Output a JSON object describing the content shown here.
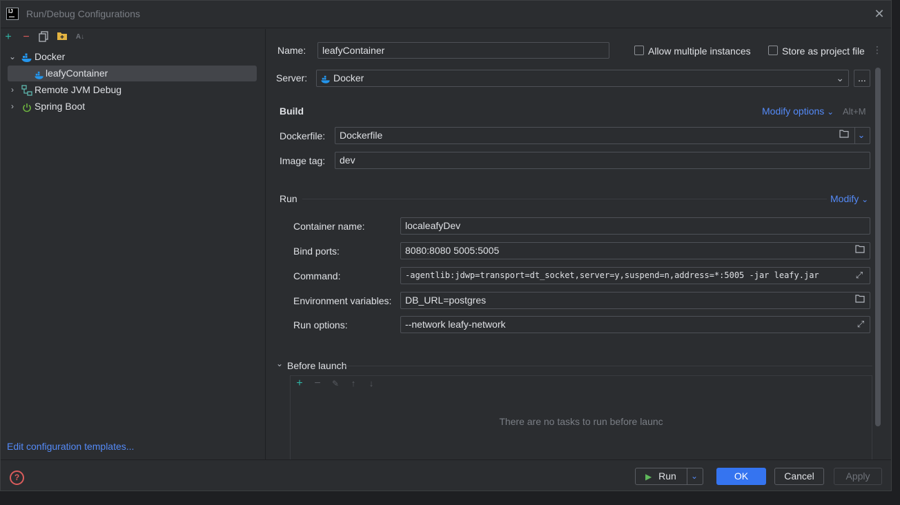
{
  "window": {
    "title": "Run/Debug Configurations",
    "app_icon_text": "IJ"
  },
  "tree": {
    "items": [
      {
        "label": "Docker",
        "icon": "docker-icon",
        "expanded": true
      },
      {
        "label": "leafyContainer",
        "icon": "docker-icon",
        "selected": true
      },
      {
        "label": "Remote JVM Debug",
        "icon": "remote-debug-icon",
        "expanded": false
      },
      {
        "label": "Spring Boot",
        "icon": "spring-boot-icon",
        "expanded": false
      }
    ],
    "edit_templates_link": "Edit configuration templates..."
  },
  "form": {
    "name_label": "Name:",
    "name_value": "leafyContainer",
    "allow_multiple_label": "Allow multiple instances",
    "allow_multiple_checked": false,
    "store_project_label": "Store as project file",
    "store_project_checked": false,
    "server_label": "Server:",
    "server_value": "Docker",
    "server_more": "...",
    "build_section": "Build",
    "modify_options_link": "Modify options",
    "modify_options_shortcut": "Alt+M",
    "dockerfile_label": "Dockerfile:",
    "dockerfile_value": "Dockerfile",
    "image_tag_label": "Image tag:",
    "image_tag_value": "dev",
    "run_section": "Run",
    "modify_link": "Modify",
    "container_name_label": "Container name:",
    "container_name_value": "localeafyDev",
    "bind_ports_label": "Bind ports:",
    "bind_ports_value": "8080:8080 5005:5005",
    "command_label": "Command:",
    "command_value": "-agentlib:jdwp=transport=dt_socket,server=y,suspend=n,address=*:5005 -jar leafy.jar",
    "env_label": "Environment variables:",
    "env_value": "DB_URL=postgres",
    "run_options_label": "Run options:",
    "run_options_value": "--network leafy-network",
    "before_launch_label": "Before launch",
    "before_launch_empty": "There are no tasks to run before launc"
  },
  "footer": {
    "help_symbol": "?",
    "run_label": "Run",
    "ok_label": "OK",
    "cancel_label": "Cancel",
    "apply_label": "Apply"
  },
  "colors": {
    "accent": "#3574f0",
    "link": "#548af7",
    "docker": "#2496ed",
    "spring": "#6db33f",
    "add": "#2fb5a6",
    "remove": "#db5c5c"
  }
}
